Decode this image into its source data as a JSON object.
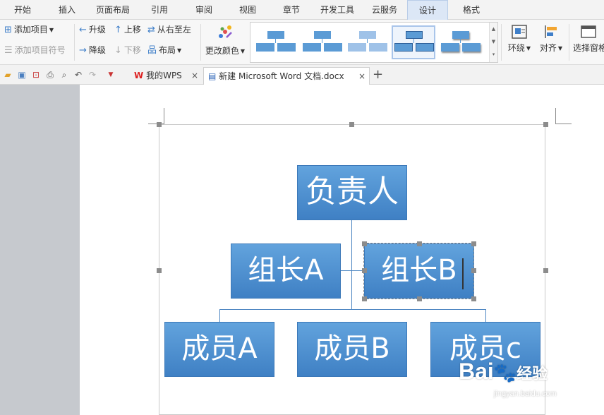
{
  "menu": {
    "tabs": [
      "开始",
      "插入",
      "页面布局",
      "引用",
      "审阅",
      "视图",
      "章节",
      "开发工具",
      "云服务",
      "设计",
      "格式"
    ]
  },
  "ribbon": {
    "add_item": "添加项目",
    "add_bullet": "添加项目符号",
    "promote": "升级",
    "demote": "降级",
    "move_up": "上移",
    "move_down": "下移",
    "right_to_left": "从右至左",
    "layout": "布局",
    "change_colors": "更改颜色",
    "wrap": "环绕",
    "align": "对齐",
    "selection_pane": "选择窗格"
  },
  "doc_tabs": {
    "tab1": "我的WPS",
    "tab2": "新建 Microsoft Word 文档.docx",
    "close": "×",
    "new": "+"
  },
  "diagram": {
    "top": "负责人",
    "left_mid": "组长A",
    "right_mid": "组长B",
    "bottom_left": "成员A",
    "bottom_mid": "成员B",
    "bottom_right": "成员c"
  },
  "watermark": {
    "brand": "Bai",
    "brand2": "经验",
    "url": "jingyan.baidu.com"
  },
  "colors": {
    "shape_fill": "#4a8cd0",
    "active_tab": "#dce7f6"
  }
}
